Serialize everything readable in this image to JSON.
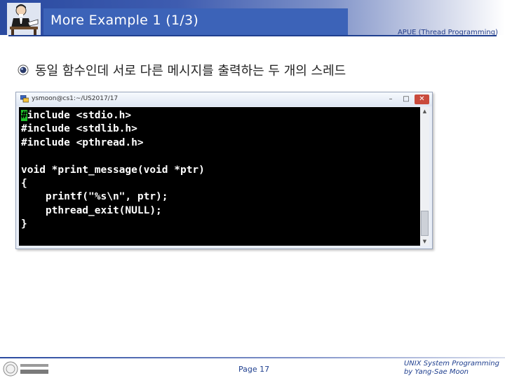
{
  "header": {
    "title": "More Example 1 (1/3)",
    "subtitle": "APUE (Thread Programming)"
  },
  "bullet": {
    "text": "동일 함수인데 서로 다른 메시지를 출력하는 두 개의 스레드"
  },
  "terminal": {
    "title": "ysmoon@cs1:~/US2017/17",
    "buttons": {
      "minimize": "–",
      "maximize": "□",
      "close": "✕"
    },
    "cursor_char": "#",
    "code_first_line_rest": "include <stdio.h>",
    "code_rest": "#include <stdlib.h>\n#include <pthread.h>\n\nvoid *print_message(void *ptr)\n{\n    printf(\"%s\\n\", ptr);\n    pthread_exit(NULL);\n}"
  },
  "footer": {
    "page": "Page 17",
    "credit_line1": "UNIX System Programming",
    "credit_line2": "by Yang-Sae Moon"
  },
  "colors": {
    "header_blue": "#3c63b8",
    "accent_navy": "#1f3f8f",
    "terminal_bg": "#000000",
    "cursor": "#1fbf2a"
  },
  "icons": {
    "header": "professor-at-desk-icon",
    "bullet": "disc-bullet-icon",
    "terminal": "putty-icon",
    "footer": "university-logo-icon"
  }
}
